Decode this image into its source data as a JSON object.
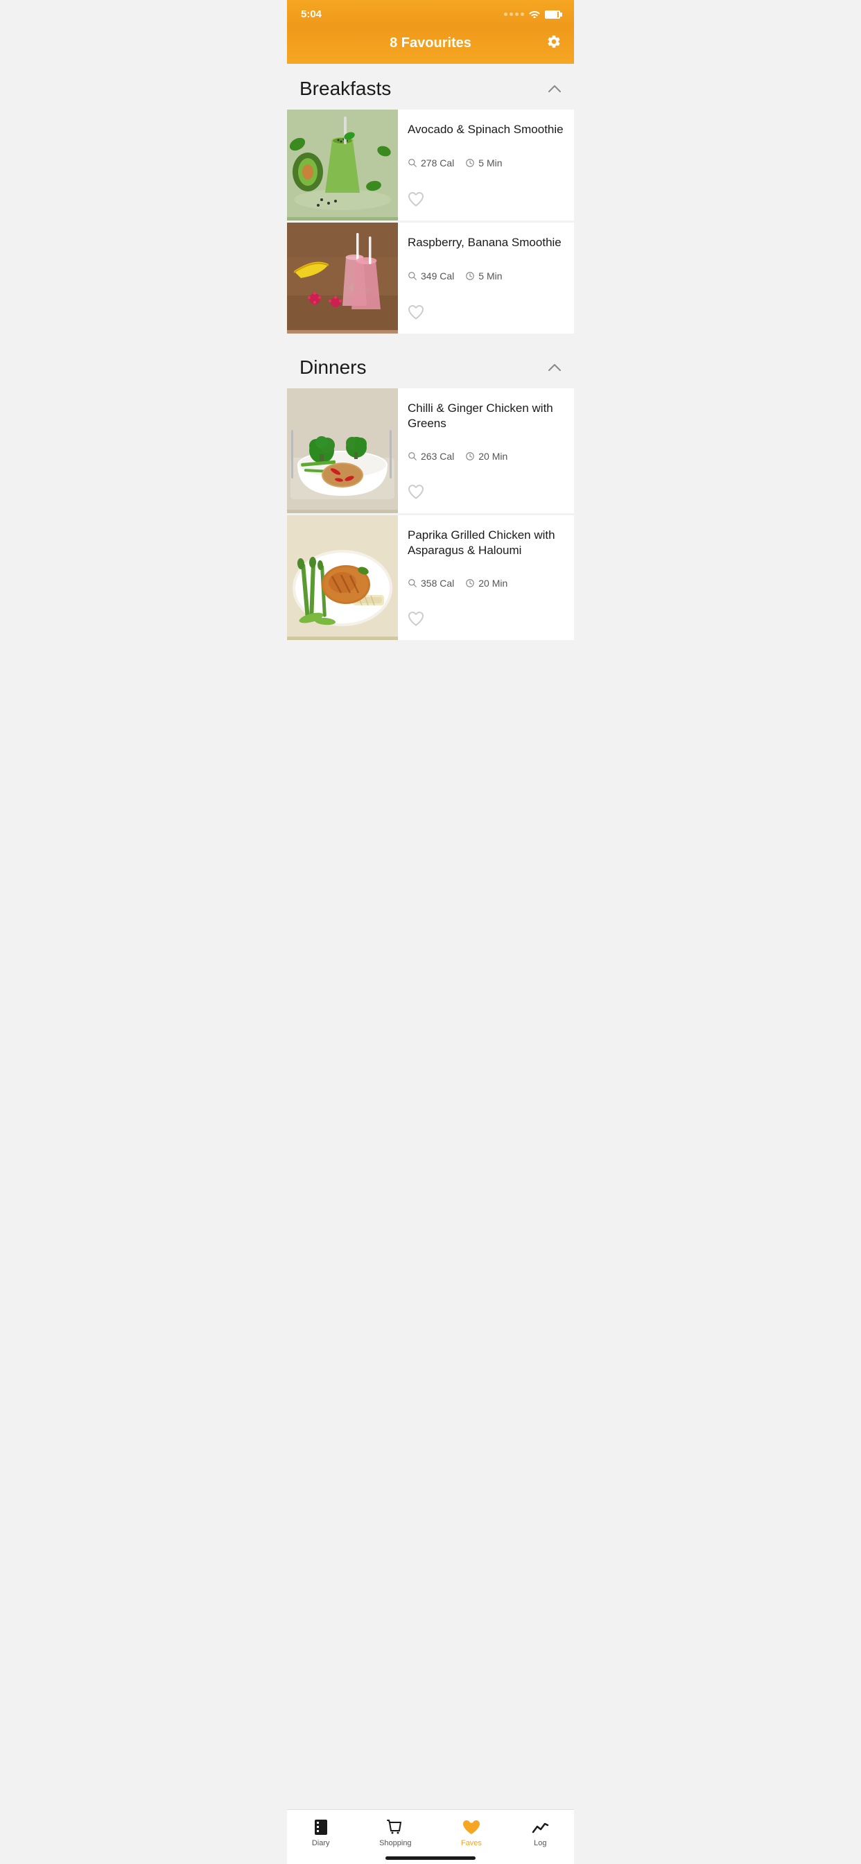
{
  "statusBar": {
    "time": "5:04"
  },
  "header": {
    "title": "8 Favourites",
    "gearLabel": "⚙"
  },
  "sections": [
    {
      "id": "breakfasts",
      "title": "Breakfasts",
      "collapsed": false,
      "recipes": [
        {
          "id": "avocado-smoothie",
          "name": "Avocado & Spinach Smoothie",
          "calories": "278 Cal",
          "time": "5 Min",
          "favorited": false
        },
        {
          "id": "raspberry-smoothie",
          "name": "Raspberry, Banana Smoothie",
          "calories": "349 Cal",
          "time": "5 Min",
          "favorited": false
        }
      ]
    },
    {
      "id": "dinners",
      "title": "Dinners",
      "collapsed": false,
      "recipes": [
        {
          "id": "chilli-ginger-chicken",
          "name": "Chilli & Ginger Chicken with Greens",
          "calories": "263 Cal",
          "time": "20 Min",
          "favorited": false
        },
        {
          "id": "paprika-chicken",
          "name": "Paprika Grilled Chicken with Asparagus & Haloumi",
          "calories": "358 Cal",
          "time": "20 Min",
          "favorited": false
        }
      ]
    }
  ],
  "tabBar": {
    "tabs": [
      {
        "id": "diary",
        "label": "Diary",
        "icon": "📓",
        "active": false
      },
      {
        "id": "shopping",
        "label": "Shopping",
        "icon": "🛍",
        "active": false
      },
      {
        "id": "faves",
        "label": "Faves",
        "icon": "♥",
        "active": true
      },
      {
        "id": "log",
        "label": "Log",
        "icon": "📈",
        "active": false
      }
    ]
  }
}
